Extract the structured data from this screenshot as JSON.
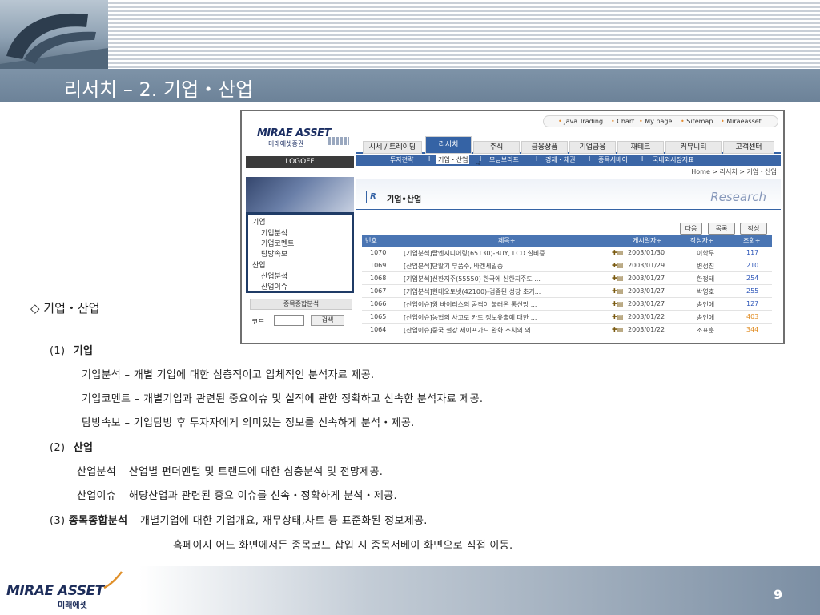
{
  "slide": {
    "title": "리서치 – 2. 기업・산업",
    "page_number": "9"
  },
  "screenshot": {
    "logo": {
      "text": "MIRAE ASSET",
      "sub": "미래에셋증권"
    },
    "logoff_label": "LOGOFF",
    "util_links": [
      "Java Trading",
      "Chart",
      "My page",
      "Sitemap",
      "Miraeasset"
    ],
    "nav_tabs": [
      "시세 / 트레이딩",
      "리서치",
      "주식",
      "금융상품",
      "기업금융",
      "재테크",
      "커뮤니티",
      "고객센터"
    ],
    "sub_nav": [
      "투자전략",
      "l",
      "기업・산업",
      "l",
      "모닝브리프",
      "l",
      "경제・채권",
      "l",
      "종목서베이",
      "l",
      "국내외시장지표"
    ],
    "breadcrumb": "Home > 리서치 > 기업・산업",
    "side_menu": {
      "group1": "기업",
      "group1_items": [
        "기업분석",
        "기업코멘트",
        "탐방속보"
      ],
      "group2": "산업",
      "group2_items": [
        "산업분석",
        "산업이슈"
      ]
    },
    "stock_search": {
      "title": "종목종합분석",
      "code_label": "코드",
      "button": "검색"
    },
    "heading": "기업•산업",
    "r_mark": "R",
    "research_mark": "Research",
    "buttons": {
      "next": "다음",
      "list": "목록",
      "write": "작성"
    },
    "table": {
      "headers": {
        "no": "번호",
        "title": "제목÷",
        "date": "게시일자÷",
        "author": "작성자÷",
        "views": "조회÷"
      },
      "rows": [
        {
          "no": "1070",
          "title": "[기업분석]탑엔지니어링(65130)-BUY, LCD 설비증...",
          "icon": "✚▤",
          "date": "2003/01/30",
          "author": "이학무",
          "views": "117"
        },
        {
          "no": "1069",
          "title": "[산업분석]단말기 부품주, 바겐세일중",
          "icon": "✚▤",
          "date": "2003/01/29",
          "author": "변성진",
          "views": "210"
        },
        {
          "no": "1068",
          "title": "[기업분석]신한지주(55550) 한국에 신한지주도 ...",
          "icon": "✚▤",
          "date": "2003/01/27",
          "author": "한정태",
          "views": "254"
        },
        {
          "no": "1067",
          "title": "[기업분석]현대오토넷(42100)-검증된 성장 초기...",
          "icon": "✚▤",
          "date": "2003/01/27",
          "author": "박영호",
          "views": "255"
        },
        {
          "no": "1066",
          "title": "[산업이슈]웜 바이러스의 공격이 불러온 통신망 ...",
          "icon": "✚▤",
          "date": "2003/01/27",
          "author": "송인애",
          "views": "127"
        },
        {
          "no": "1065",
          "title": "[산업이슈]농협의 사고로 카드 정보유출에 대한 ...",
          "icon": "✚▤",
          "date": "2003/01/22",
          "author": "송인애",
          "views": "403"
        },
        {
          "no": "1064",
          "title": "[산업이슈]중국 철강 세이프가드 완화 조치의 의...",
          "icon": "✚▤",
          "date": "2003/01/22",
          "author": "조표훈",
          "views": "344"
        }
      ]
    }
  },
  "body": {
    "diamond_heading": "◇ 기업・산업",
    "sec1_num": "(1)",
    "sec1_title": "기업",
    "sec1_lines": [
      "기업분석  – 개별 기업에 대한 심층적이고 입체적인 분석자료 제공.",
      "기업코멘트  –  개별기업과 관련된 중요이슈 및 실적에 관한 정확하고 신속한 분석자료 제공.",
      "탐방속보  –  기업탐방 후 투자자에게 의미있는 정보를 신속하게 분석・제공."
    ],
    "sec2_num": "(2)",
    "sec2_title": "산업",
    "sec2_lines": [
      "산업분석  –  산업별 펀더멘털 및 트랜드에 대한 심층분석 및 전망제공.",
      "산업이슈  –  해당산업과 관련된 중요 이슈를 신속・정확하게 분석・제공."
    ],
    "sec3_num": "(3)",
    "sec3_title": "종목종합분석",
    "sec3_desc": "– 개별기업에 대한 기업개요, 재무상태,차트 등 표준화된 정보제공.",
    "sec3_line2": "홈페이지 어느 화면에서든 종목코드 삽입 시 종목서베이 화면으로 직접 이동."
  },
  "footer": {
    "logo": "MIRAE ASSET",
    "logo_sub": "미래에셋"
  },
  "colors": {
    "accent_blue": "#3563a5",
    "title_bar": "#7388a0",
    "views_orange": "#e08a1e"
  }
}
